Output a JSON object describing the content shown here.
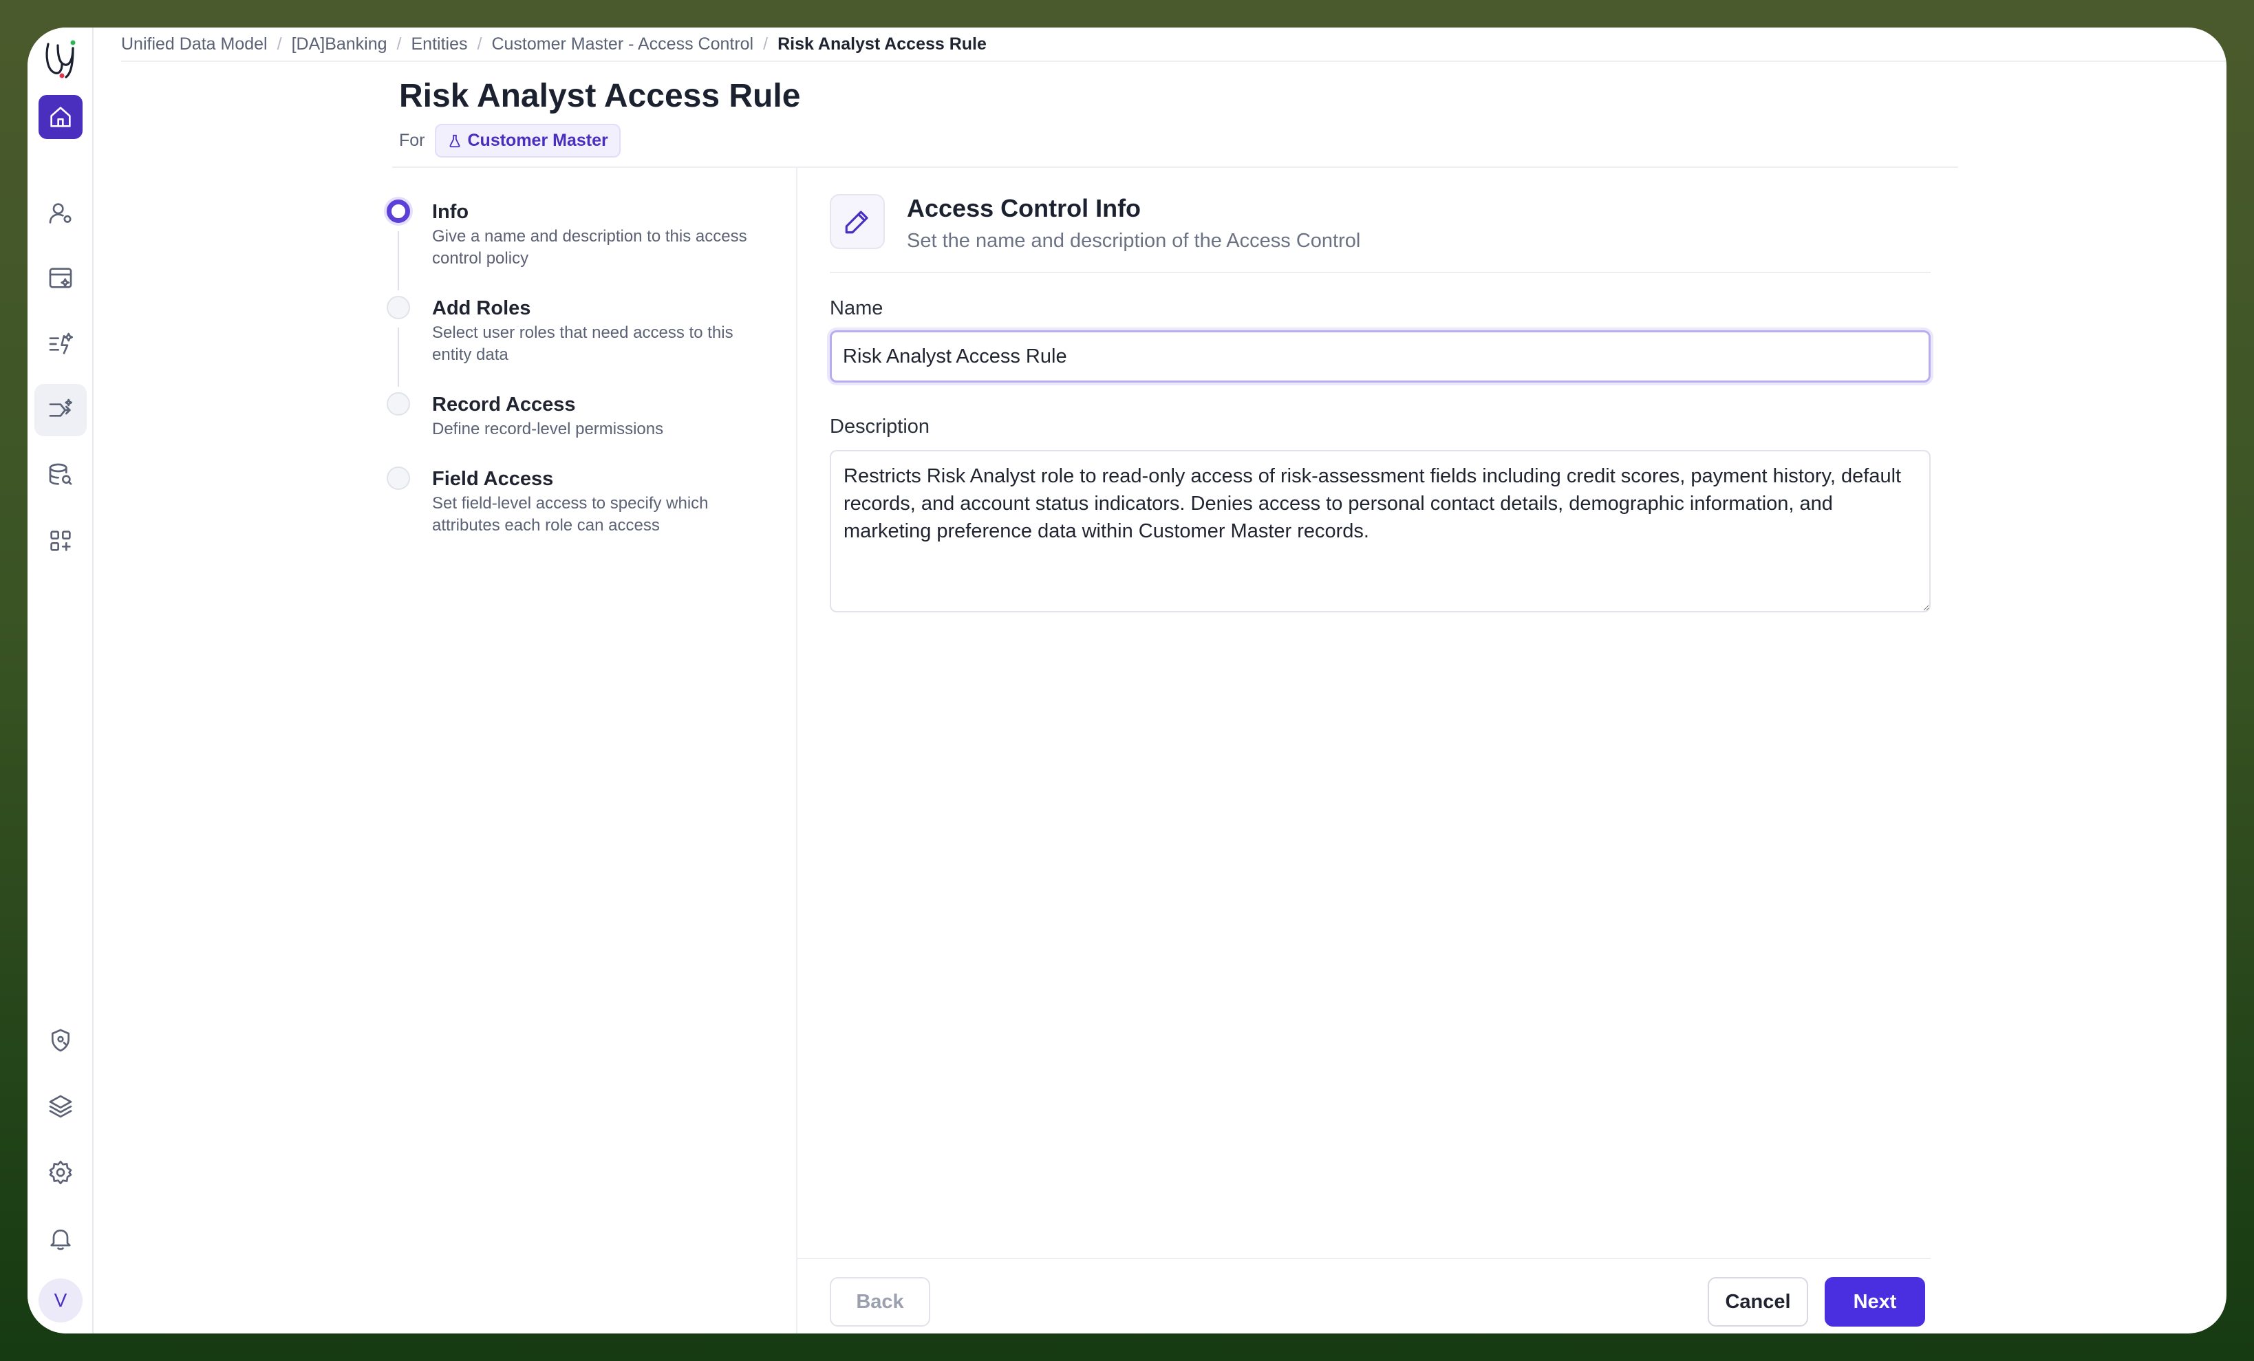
{
  "breadcrumb": [
    "Unified Data Model",
    "[DA]Banking",
    "Entities",
    "Customer Master - Access Control",
    "Risk Analyst Access Rule"
  ],
  "header": {
    "title": "Risk Analyst Access Rule",
    "for_label": "For",
    "entity": "Customer Master"
  },
  "steps": [
    {
      "title": "Info",
      "desc": "Give a name and description to this access control policy",
      "state": "active"
    },
    {
      "title": "Add Roles",
      "desc": "Select user roles that need access to this entity data",
      "state": "pending"
    },
    {
      "title": "Record Access",
      "desc": "Define record-level permissions",
      "state": "pending"
    },
    {
      "title": "Field Access",
      "desc": "Set field-level access to specify which attributes each role can access",
      "state": "pending"
    }
  ],
  "panel": {
    "title": "Access Control Info",
    "subtitle": "Set the name and description of the Access Control",
    "name_label": "Name",
    "name_value": "Risk Analyst Access Rule",
    "description_label": "Description",
    "description_value": "Restricts Risk Analyst role to read-only access of risk-assessment fields including credit scores, payment history, default records, and account status indicators. Denies access to personal contact details, demographic information, and marketing preference data within Customer Master records."
  },
  "footer": {
    "back": "Back",
    "cancel": "Cancel",
    "next": "Next"
  },
  "sidebar": {
    "avatar_initial": "V",
    "icons": [
      "home-icon",
      "user-settings-icon",
      "data-card-icon",
      "sparkle-list-icon",
      "workflow-icon",
      "database-search-icon",
      "apps-grid-icon",
      "shield-icon",
      "layers-icon",
      "gear-icon",
      "bell-icon"
    ]
  },
  "colors": {
    "accent": "#4a2fe0",
    "home_bg": "#4a2fbf",
    "chip_text": "#4a2fbf"
  }
}
